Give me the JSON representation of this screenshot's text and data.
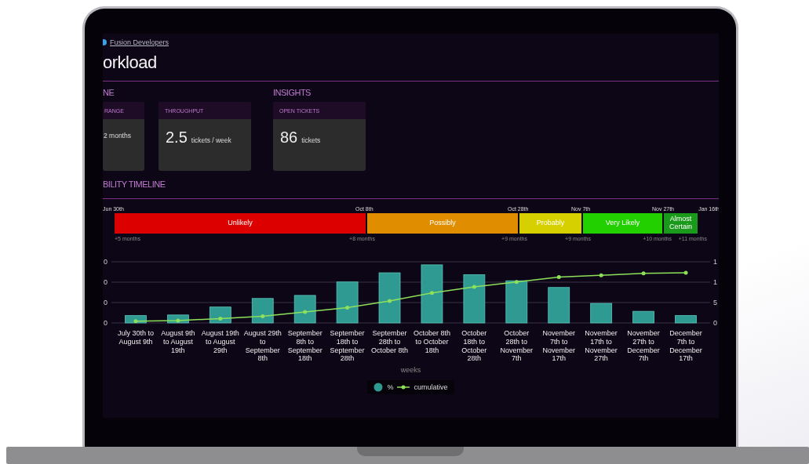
{
  "breadcrumb": {
    "link": "Fusion Developers"
  },
  "title": "orkload",
  "sections": [
    {
      "title": "NE",
      "cards": [
        {
          "kind": "plain",
          "label": "RANGE",
          "text": "2 months"
        },
        {
          "kind": "metric",
          "label": "THROUGHPUT",
          "value": "2.5",
          "unit": "tickets / week"
        }
      ]
    },
    {
      "title": "INSIGHTS",
      "cards": [
        {
          "kind": "metric",
          "label": "OPEN TICKETS",
          "value": "86",
          "unit": "tickets"
        }
      ]
    }
  ],
  "timeline": {
    "title": "BILITY TIMELINE",
    "start_offset": "+5 months",
    "end_date": "Jan 16th",
    "segments": [
      {
        "label": "Unlikely",
        "color": "#dd0000",
        "start_date": "Jun 30th",
        "end_offset": "+8 months"
      },
      {
        "label": "Possibly",
        "color": "#e08e00",
        "start_date": "Oct 8th",
        "end_offset": "+9 months"
      },
      {
        "label": "Probably",
        "color": "#d6d000",
        "start_date": "Oct 28th",
        "end_offset": "+9 months"
      },
      {
        "label": "Very Likely",
        "color": "#22d000",
        "start_date": "Nov 7th",
        "end_offset": "+10 months"
      },
      {
        "label": "Almost Certain",
        "color": "#1a9a1a",
        "start_date": "Nov 27th",
        "end_offset": "+11 months"
      }
    ]
  },
  "chart": {
    "xlabel": "weeks",
    "categories": [
      "July 30th to August 9th",
      "August 9th to August 19th",
      "August 19th to August 29th",
      "August 29th to September 8th",
      "September 8th to September 18th",
      "September 18th to September 28th",
      "September 28th to October 8th",
      "October 8th to October 18th",
      "October 18th to October 28th",
      "October 28th to November 7th",
      "November 7th to November 17th",
      "November 17th to November 27th",
      "November 27th to December 7th",
      "December 7th to December 17th"
    ],
    "legend": [
      {
        "name": "%",
        "kind": "bar",
        "color": "#2e9a92"
      },
      {
        "name": "cumulative",
        "kind": "line",
        "color": "#8ee05a"
      }
    ],
    "left_axis_labels": [
      "0",
      "0",
      "0",
      "0"
    ],
    "right_axis_labels": [
      "1",
      "1",
      "5",
      "0"
    ]
  }
}
